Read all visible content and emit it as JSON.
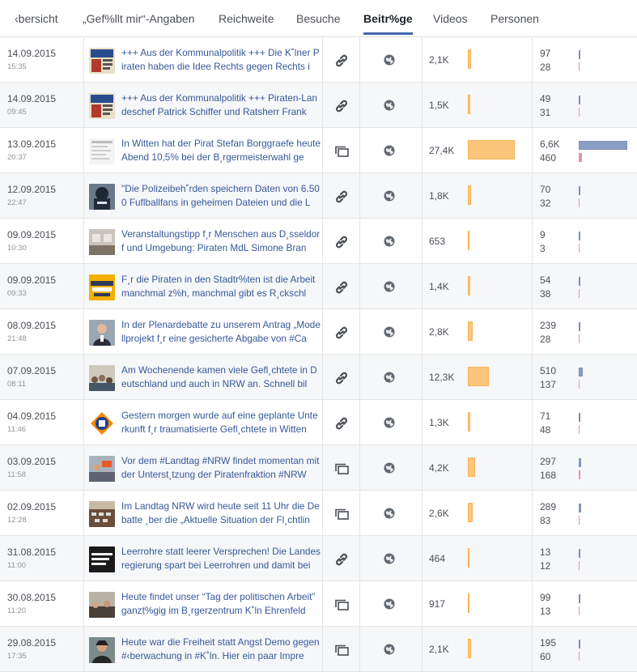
{
  "tabs": [
    {
      "label": "‹bersicht",
      "active": false
    },
    {
      "label": "„Gef%llt mir“-Angaben",
      "active": false
    },
    {
      "label": "Reichweite",
      "active": false
    },
    {
      "label": "Besuche",
      "active": false
    },
    {
      "label": "Beitr%ge",
      "active": true
    },
    {
      "label": "Videos",
      "active": false
    },
    {
      "label": "Personen",
      "active": false
    }
  ],
  "colors": {
    "reach_bar": "#fbc67c",
    "engagement_bar": "#8b9dc3",
    "secondary_bar": "#e195a8",
    "link_text": "#365899"
  },
  "reach_max": 27400,
  "engagement_max": 6600,
  "posts": [
    {
      "date": "14.09.2015",
      "time": "15:35",
      "text": "+++ Aus der Kommunalpolitik +++ Die K˚lner Piraten haben die Idee Rechts gegen Rechts i",
      "type_icon": "link-icon",
      "reach": "2,1K",
      "reach_value": 2100,
      "eng1": "97",
      "eng1_value": 97,
      "eng2": "28",
      "eng2_value": 28,
      "thumb": "thumb-news"
    },
    {
      "date": "14.09.2015",
      "time": "09:45",
      "text": "+++ Aus der Kommunalpolitik +++ Piraten-Landeschef Patrick Schiffer und Ratsherr Frank",
      "type_icon": "link-icon",
      "reach": "1,5K",
      "reach_value": 1500,
      "eng1": "49",
      "eng1_value": 49,
      "eng2": "31",
      "eng2_value": 31,
      "thumb": "thumb-news"
    },
    {
      "date": "13.09.2015",
      "time": "20:37",
      "text": "In Witten hat der Pirat Stefan Borggraefe heute Abend 10,5% bei der B¸rgermeisterwahl ge",
      "type_icon": "status-icon",
      "reach": "27,4K",
      "reach_value": 27400,
      "eng1": "6,6K",
      "eng1_value": 6600,
      "eng2": "460",
      "eng2_value": 460,
      "thumb": "thumb-doc"
    },
    {
      "date": "12.09.2015",
      "time": "22:47",
      "text": "\"Die Polizeibeh˚rden speichern Daten von 6.500 Fuflballfans in geheimen Dateien und die L",
      "type_icon": "link-icon",
      "reach": "1,8K",
      "reach_value": 1800,
      "eng1": "70",
      "eng1_value": 70,
      "eng2": "32",
      "eng2_value": 32,
      "thumb": "thumb-police"
    },
    {
      "date": "09.09.2015",
      "time": "10:30",
      "text": "Veranstaltungstipp f¸r Menschen aus D¸sseldorf und Umgebung: Piraten MdL Simone Bran",
      "type_icon": "link-icon",
      "reach": "653",
      "reach_value": 653,
      "eng1": "9",
      "eng1_value": 9,
      "eng2": "3",
      "eng2_value": 3,
      "thumb": "thumb-room"
    },
    {
      "date": "09.09.2015",
      "time": "09:33",
      "text": "F¸r die Piraten in den Stadtr%ten ist die Arbeit manchmal z%h, manchmal gibt es R¸ckschl",
      "type_icon": "link-icon",
      "reach": "1,4K",
      "reach_value": 1400,
      "eng1": "54",
      "eng1_value": 54,
      "eng2": "38",
      "eng2_value": 38,
      "thumb": "thumb-yellow"
    },
    {
      "date": "08.09.2015",
      "time": "21:48",
      "text": "In der Plenardebatte zu unserem Antrag „Modellprojekt f¸r eine gesicherte Abgabe von #Ca",
      "type_icon": "link-icon",
      "reach": "2,8K",
      "reach_value": 2800,
      "eng1": "239",
      "eng1_value": 239,
      "eng2": "28",
      "eng2_value": 28,
      "thumb": "thumb-speaker"
    },
    {
      "date": "07.09.2015",
      "time": "08:11",
      "text": "Am Wochenende kamen viele Gefl¸chtete in Deutschland und auch in NRW an. Schnell bil",
      "type_icon": "link-icon",
      "reach": "12,3K",
      "reach_value": 12300,
      "eng1": "510",
      "eng1_value": 510,
      "eng2": "137",
      "eng2_value": 137,
      "thumb": "thumb-crowd"
    },
    {
      "date": "04.09.2015",
      "time": "11:46",
      "text": "Gestern morgen wurde auf eine geplante Unterkunft f¸r traumatisierte Gefl¸chtete in Witten",
      "type_icon": "link-icon",
      "reach": "1,3K",
      "reach_value": 1300,
      "eng1": "71",
      "eng1_value": 71,
      "eng2": "48",
      "eng2_value": 48,
      "thumb": "thumb-logo"
    },
    {
      "date": "03.09.2015",
      "time": "11:58",
      "text": "Vor dem #Landtag #NRW findet momentan mit der Unterst¸tzung der Piratenfraktion #NRW",
      "type_icon": "status-icon",
      "reach": "4,2K",
      "reach_value": 4200,
      "eng1": "297",
      "eng1_value": 297,
      "eng2": "168",
      "eng2_value": 168,
      "thumb": "thumb-rally"
    },
    {
      "date": "02.09.2015",
      "time": "12:28",
      "text": "Im Landtag NRW wird heute seit 11 Uhr die Debatte ¸ber die „Aktuelle Situation der Fl¸chtlin",
      "type_icon": "status-icon",
      "reach": "2,6K",
      "reach_value": 2600,
      "eng1": "289",
      "eng1_value": 289,
      "eng2": "83",
      "eng2_value": 83,
      "thumb": "thumb-plenary"
    },
    {
      "date": "31.08.2015",
      "time": "11:00",
      "text": "Leerrohre statt leerer Versprechen! Die Landesregierung spart bei Leerrohren und damit bei",
      "type_icon": "link-icon",
      "reach": "464",
      "reach_value": 464,
      "eng1": "13",
      "eng1_value": 13,
      "eng2": "12",
      "eng2_value": 12,
      "thumb": "thumb-dark"
    },
    {
      "date": "30.08.2015",
      "time": "11:20",
      "text": "Heute findet unser “Tag der politischen Arbeit” ganzt%gig im B¸rgerzentrum K˚ln Ehrenfeld",
      "type_icon": "status-icon",
      "reach": "917",
      "reach_value": 917,
      "eng1": "99",
      "eng1_value": 99,
      "eng2": "13",
      "eng2_value": 13,
      "thumb": "thumb-meeting"
    },
    {
      "date": "29.08.2015",
      "time": "17:35",
      "text": "Heute war die Freiheit statt Angst Demo gegen #‹berwachung in #K˚ln. Hier ein paar Impre",
      "type_icon": "status-icon",
      "reach": "2,1K",
      "reach_value": 2100,
      "eng1": "195",
      "eng1_value": 195,
      "eng2": "60",
      "eng2_value": 60,
      "thumb": "thumb-demo"
    }
  ]
}
